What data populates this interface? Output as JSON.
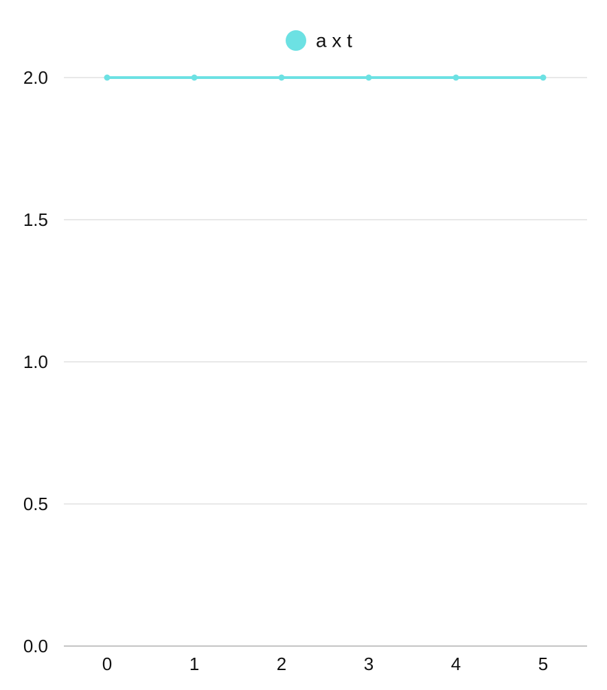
{
  "chart_data": {
    "type": "line",
    "x": [
      0,
      1,
      2,
      3,
      4,
      5
    ],
    "x_tick_labels": [
      "0",
      "1",
      "2",
      "3",
      "4",
      "5"
    ],
    "y_tick_labels": [
      "0.0",
      "0.5",
      "1.0",
      "1.5",
      "2.0"
    ],
    "y_ticks": [
      0,
      0.5,
      1.0,
      1.5,
      2.0
    ],
    "ylim": [
      0,
      2.0
    ],
    "grid": true,
    "legend_position": "top-center",
    "series": [
      {
        "name": "a x t",
        "values": [
          2,
          2,
          2,
          2,
          2,
          2
        ],
        "color": "#6ce1e3"
      }
    ]
  }
}
